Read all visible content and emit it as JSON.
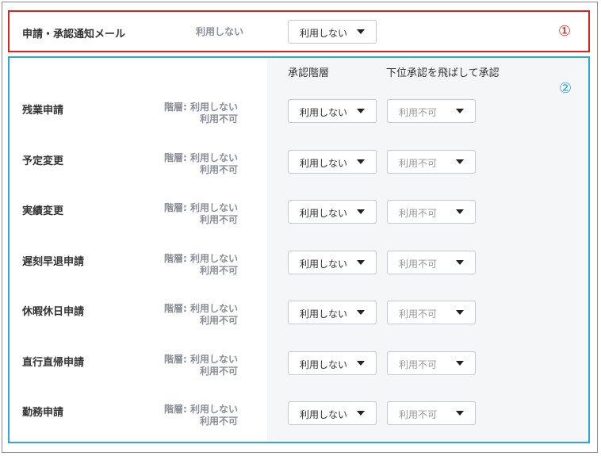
{
  "section1": {
    "label": "申請・承認通知メール",
    "value": "利用しない",
    "dropdown": "利用しない",
    "marker": "①",
    "marker_color": "#e0201e"
  },
  "section2": {
    "marker": "②",
    "marker_color": "#2ea7d8",
    "headers": {
      "level": "承認階層",
      "skip": "下位承認を飛ばして承認"
    },
    "rows": [
      {
        "label": "残業申請",
        "value_line1": "階層: 利用しない",
        "value_line2": "利用不可",
        "level_dropdown": "利用しない",
        "skip_dropdown": "利用不可"
      },
      {
        "label": "予定変更",
        "value_line1": "階層: 利用しない",
        "value_line2": "利用不可",
        "level_dropdown": "利用しない",
        "skip_dropdown": "利用不可"
      },
      {
        "label": "実績変更",
        "value_line1": "階層: 利用しない",
        "value_line2": "利用不可",
        "level_dropdown": "利用しない",
        "skip_dropdown": "利用不可"
      },
      {
        "label": "遅刻早退申請",
        "value_line1": "階層: 利用しない",
        "value_line2": "利用不可",
        "level_dropdown": "利用しない",
        "skip_dropdown": "利用不可"
      },
      {
        "label": "休暇休日申請",
        "value_line1": "階層: 利用しない",
        "value_line2": "利用不可",
        "level_dropdown": "利用しない",
        "skip_dropdown": "利用不可"
      },
      {
        "label": "直行直帰申請",
        "value_line1": "階層: 利用しない",
        "value_line2": "利用不可",
        "level_dropdown": "利用しない",
        "skip_dropdown": "利用不可"
      },
      {
        "label": "勤務申請",
        "value_line1": "階層: 利用しない",
        "value_line2": "利用不可",
        "level_dropdown": "利用しない",
        "skip_dropdown": "利用不可"
      }
    ]
  },
  "colors": {
    "section1_border": "#e0201e",
    "section2_border": "#2ea7d8",
    "muted_text": "#8a8f98"
  }
}
